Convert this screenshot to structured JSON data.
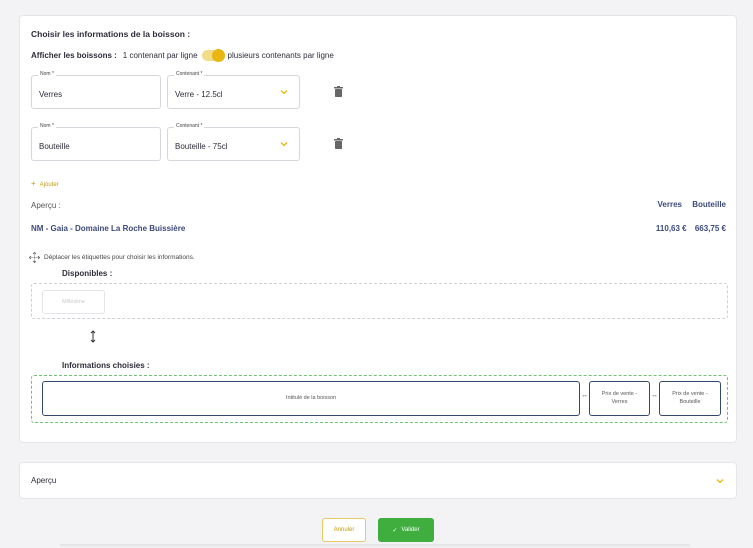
{
  "section": {
    "title": "Choisir les informations de la boisson :",
    "display_label": "Afficher les boissons :",
    "option_single": "1 contenant par ligne",
    "option_multi": "plusieurs contenants par ligne",
    "toggle_on": true
  },
  "containers": [
    {
      "name_label": "Nom *",
      "name_value": "Verres",
      "container_label": "Contenant *",
      "container_value": "Verre - 12.5cl"
    },
    {
      "name_label": "Nom *",
      "name_value": "Bouteille",
      "container_label": "Contenant *",
      "container_value": "Bouteille - 75cl"
    }
  ],
  "add_label": "Ajouter",
  "preview": {
    "label": "Aperçu :",
    "col_headers": [
      "Verres",
      "Bouteille"
    ],
    "drink_name": "NM - Gaia - Domaine La Roche Buissière",
    "prices": [
      "110,63 €",
      "663,75 €"
    ]
  },
  "labels": {
    "move_hint": "Déplacer les étiquettes pour choisir les informations.",
    "available_title": "Disponibles :",
    "available_chip": "Millésime",
    "chosen_title": "Informations choisies :",
    "chosen_chips": [
      "Intitulé de la boisson",
      "Prix de vente - Verres",
      "Prix de vente - Bouteille"
    ]
  },
  "collapsed_section": {
    "label": "Aperçu"
  },
  "buttons": {
    "cancel": "Annuler",
    "validate": "Valider"
  },
  "colors": {
    "accent": "#e8b711",
    "navy": "#35486c",
    "success": "#3fae3f"
  }
}
